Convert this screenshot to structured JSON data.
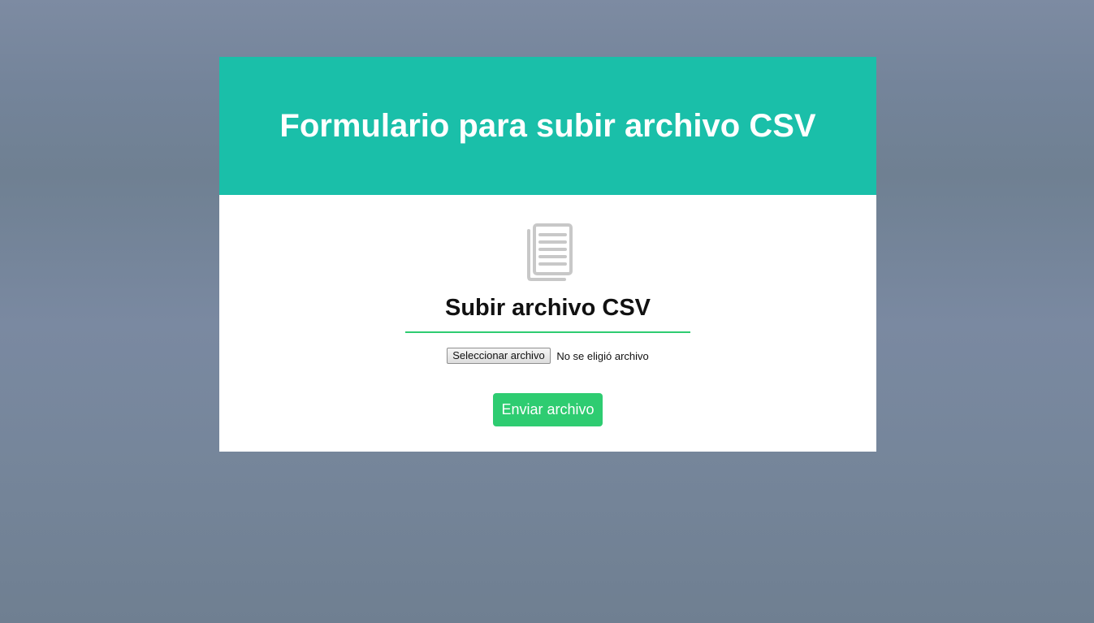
{
  "header": {
    "title": "Formulario para subir archivo CSV"
  },
  "form": {
    "icon": "document-icon",
    "title": "Subir archivo CSV",
    "file_button_label": "Seleccionar archivo",
    "file_status": "No se eligió archivo",
    "submit_label": "Enviar archivo"
  },
  "colors": {
    "header_bg": "#1abfa9",
    "accent": "#2ecc71",
    "icon": "#c8c8c8"
  }
}
